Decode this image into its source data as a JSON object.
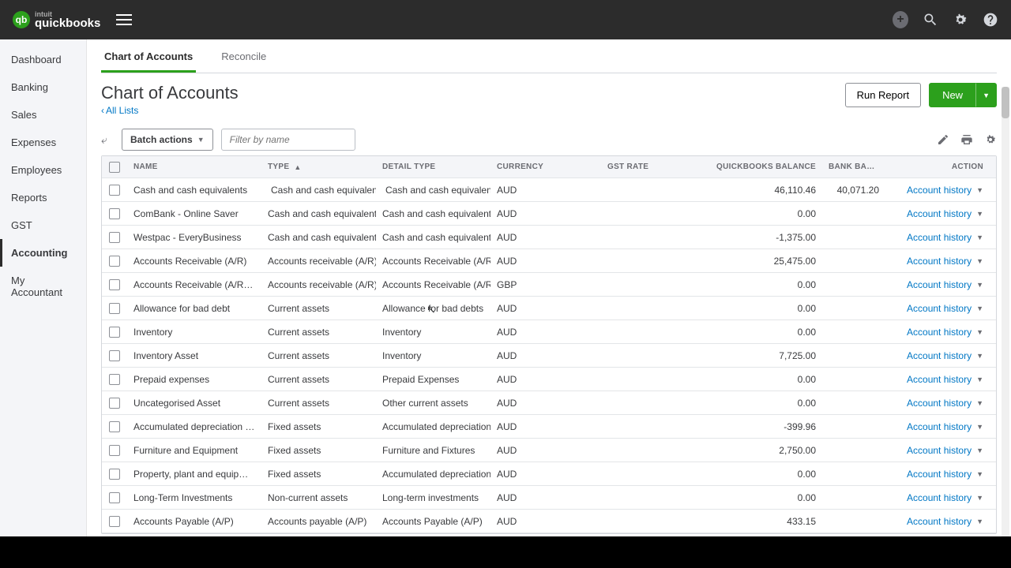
{
  "app_name": "quickbooks",
  "brand_small": "intuit",
  "sidebar": {
    "items": [
      {
        "label": "Dashboard"
      },
      {
        "label": "Banking"
      },
      {
        "label": "Sales"
      },
      {
        "label": "Expenses"
      },
      {
        "label": "Employees"
      },
      {
        "label": "Reports"
      },
      {
        "label": "GST"
      },
      {
        "label": "Accounting"
      },
      {
        "label": "My Accountant"
      }
    ],
    "active_index": 7
  },
  "tabs": {
    "items": [
      {
        "label": "Chart of Accounts"
      },
      {
        "label": "Reconcile"
      }
    ],
    "active_index": 0
  },
  "page": {
    "title": "Chart of Accounts",
    "back": "All Lists",
    "run_report": "Run Report",
    "new": "New"
  },
  "controls": {
    "batch": "Batch actions",
    "filter_placeholder": "Filter by name"
  },
  "columns": {
    "name": "NAME",
    "type": "TYPE",
    "detail": "DETAIL TYPE",
    "currency": "CURRENCY",
    "gst": "GST RATE",
    "qb": "QUICKBOOKS BALANCE",
    "bank": "BANK BALANCE",
    "action": "ACTION"
  },
  "action_label": "Account history",
  "rows": [
    {
      "name": "Cash and cash equivalents",
      "type": "Cash and cash equivalents",
      "detail": "Cash and cash equivalents",
      "currency": "AUD",
      "gst": "",
      "qb": "46,110.46",
      "bank": "40,071.20",
      "icon": true
    },
    {
      "name": "ComBank - Online Saver",
      "type": "Cash and cash equivalents",
      "detail": "Cash and cash equivalents",
      "currency": "AUD",
      "gst": "",
      "qb": "0.00",
      "bank": ""
    },
    {
      "name": "Westpac - EveryBusiness",
      "type": "Cash and cash equivalents",
      "detail": "Cash and cash equivalents",
      "currency": "AUD",
      "gst": "",
      "qb": "-1,375.00",
      "bank": ""
    },
    {
      "name": "Accounts Receivable (A/R)",
      "type": "Accounts receivable (A/R)",
      "detail": "Accounts Receivable (A/R)",
      "currency": "AUD",
      "gst": "",
      "qb": "25,475.00",
      "bank": ""
    },
    {
      "name": "Accounts Receivable (A/R) - GBP",
      "type": "Accounts receivable (A/R)",
      "detail": "Accounts Receivable (A/R)",
      "currency": "GBP",
      "gst": "",
      "qb": "0.00",
      "bank": ""
    },
    {
      "name": "Allowance for bad debt",
      "type": "Current assets",
      "detail": "Allowance for bad debts",
      "currency": "AUD",
      "gst": "",
      "qb": "0.00",
      "bank": ""
    },
    {
      "name": "Inventory",
      "type": "Current assets",
      "detail": "Inventory",
      "currency": "AUD",
      "gst": "",
      "qb": "0.00",
      "bank": ""
    },
    {
      "name": "Inventory Asset",
      "type": "Current assets",
      "detail": "Inventory",
      "currency": "AUD",
      "gst": "",
      "qb": "7,725.00",
      "bank": ""
    },
    {
      "name": "Prepaid expenses",
      "type": "Current assets",
      "detail": "Prepaid Expenses",
      "currency": "AUD",
      "gst": "",
      "qb": "0.00",
      "bank": ""
    },
    {
      "name": "Uncategorised Asset",
      "type": "Current assets",
      "detail": "Other current assets",
      "currency": "AUD",
      "gst": "",
      "qb": "0.00",
      "bank": ""
    },
    {
      "name": "Accumulated depreciation on property, p",
      "type": "Fixed assets",
      "detail": "Accumulated depreciation on …",
      "currency": "AUD",
      "gst": "",
      "qb": "-399.96",
      "bank": ""
    },
    {
      "name": "Furniture and Equipment",
      "type": "Fixed assets",
      "detail": "Furniture and Fixtures",
      "currency": "AUD",
      "gst": "",
      "qb": "2,750.00",
      "bank": ""
    },
    {
      "name": "Property, plant and equipment",
      "type": "Fixed assets",
      "detail": "Accumulated depreciation on …",
      "currency": "AUD",
      "gst": "",
      "qb": "0.00",
      "bank": ""
    },
    {
      "name": "Long-Term Investments",
      "type": "Non-current assets",
      "detail": "Long-term investments",
      "currency": "AUD",
      "gst": "",
      "qb": "0.00",
      "bank": ""
    },
    {
      "name": "Accounts Payable (A/P)",
      "type": "Accounts payable (A/P)",
      "detail": "Accounts Payable (A/P)",
      "currency": "AUD",
      "gst": "",
      "qb": "433.15",
      "bank": ""
    }
  ]
}
